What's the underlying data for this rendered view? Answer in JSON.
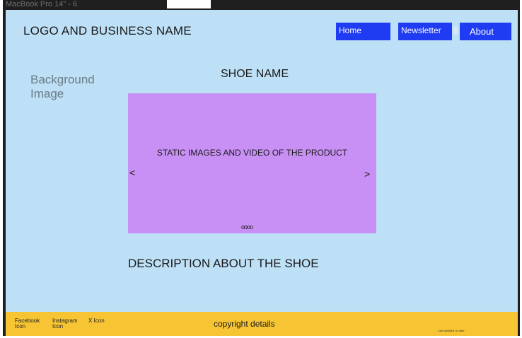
{
  "window": {
    "title": "MacBook Pro 14\" - 6"
  },
  "header": {
    "logo_text": "LOGO AND BUSINESS NAME"
  },
  "nav": {
    "items": [
      "Home",
      "Newsletter",
      "About"
    ]
  },
  "hero": {
    "background_label": "Background Image",
    "shoe_name": "SHOE NAME",
    "media_text": "STATIC IMAGES AND VIDEO OF THE PRODUCT",
    "prev_arrow": "<",
    "next_arrow": ">",
    "carousel_dots": "oooo"
  },
  "description": {
    "text": "DESCRIPTION ABOUT THE SHOE"
  },
  "footer": {
    "social": [
      {
        "line1": "Facebook",
        "line2": "Icon"
      },
      {
        "line1": "Instagram",
        "line2": "Icon"
      },
      {
        "line1": "X Icon",
        "line2": ""
      }
    ],
    "copyright": "copyright details",
    "last_updated": "Last updated on date"
  },
  "colors": {
    "background": "#bde0f6",
    "nav_button": "#1f3cf2",
    "media_panel": "#c890f4",
    "footer": "#f7c533"
  }
}
